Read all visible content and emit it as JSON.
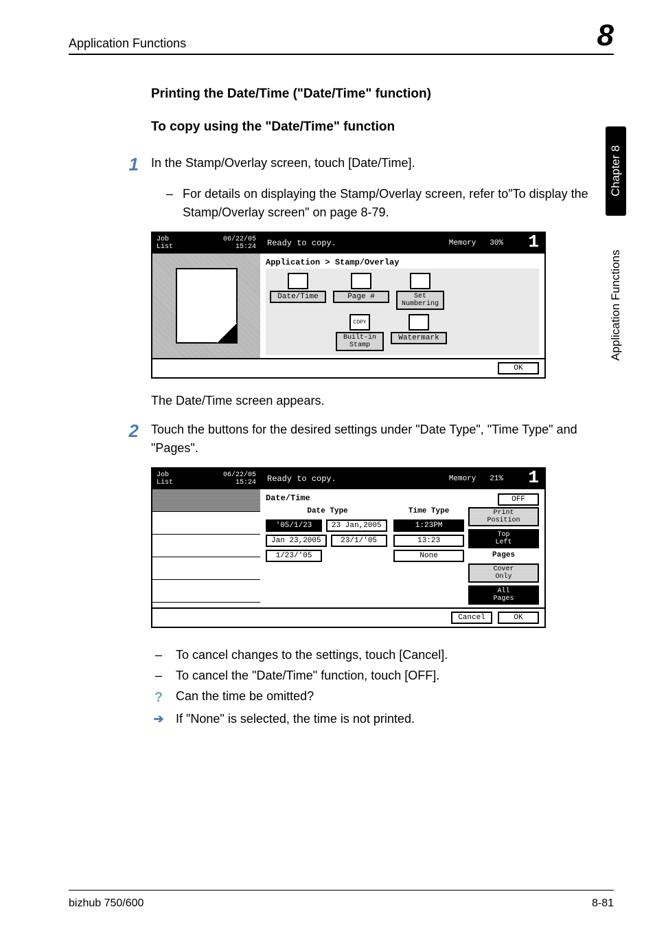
{
  "header": {
    "left": "Application Functions",
    "chapter_num": "8"
  },
  "side": {
    "black": "Chapter 8",
    "white": "Application Functions"
  },
  "h1": "Printing the Date/Time (\"Date/Time\" function)",
  "h2": "To copy using the \"Date/Time\" function",
  "step1": {
    "num": "1",
    "text": "In the Stamp/Overlay screen, touch [Date/Time].",
    "sub": "For details on displaying the Stamp/Overlay screen, refer to\"To display the Stamp/Overlay screen\" on page 8-79."
  },
  "screen1": {
    "joblist": "Job\nList",
    "date": "06/22/05",
    "time": "15:24",
    "ready": "Ready to copy.",
    "memory_label": "Memory",
    "memory_val": "30%",
    "counter": "1",
    "breadcrumb": "Application > Stamp/Overlay",
    "opts": {
      "datetime": "Date/Time",
      "page": "Page #",
      "setnum": "Set\nNumbering",
      "builtin": "Built-in\nStamp",
      "watermark": "Watermark"
    },
    "ok": "OK"
  },
  "para1": "The Date/Time screen appears.",
  "step2": {
    "num": "2",
    "text": "Touch the buttons for the desired settings under \"Date Type\", \"Time Type\" and \"Pages\"."
  },
  "screen2": {
    "joblist": "Job\nList",
    "date": "06/22/05",
    "time": "15:24",
    "ready": "Ready to copy.",
    "memory_label": "Memory",
    "memory_val": "21%",
    "counter": "1",
    "title": "Date/Time",
    "off": "OFF",
    "date_type_label": "Date Type",
    "time_type_label": "Time Type",
    "print_pos_label": "Print\nPosition",
    "print_pos_val": "Top\nLeft",
    "pages_label": "Pages",
    "date_opts": [
      "'05/1/23",
      "23 Jan,2005",
      "Jan 23,2005",
      "23/1/'05",
      "1/23/'05"
    ],
    "time_opts": [
      "1:23PM",
      "13:23",
      "None"
    ],
    "pages_opts": [
      "Cover\nOnly",
      "All\nPages"
    ],
    "cancel": "Cancel",
    "ok": "OK"
  },
  "notes": {
    "dash": "–",
    "n1": "To cancel changes to the settings, touch [Cancel].",
    "n2": "To cancel the \"Date/Time\" function, touch [OFF].",
    "q": "Can the time be omitted?",
    "a": "If \"None\" is selected, the time is not printed."
  },
  "footer": {
    "left": "bizhub 750/600",
    "right": "8-81"
  }
}
